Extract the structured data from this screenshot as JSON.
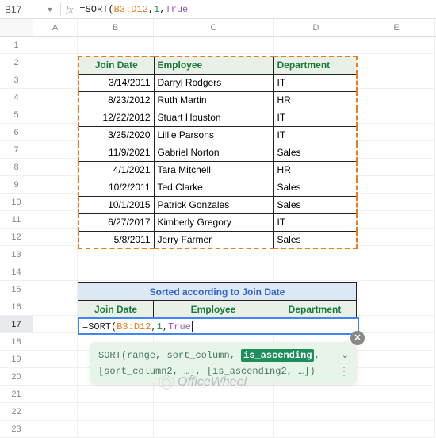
{
  "cellRef": "B17",
  "fxLabel": "fx",
  "formula": {
    "eq": "=",
    "fn": "SORT",
    "open": "(",
    "range": "B3:D12",
    "comma1": ",",
    "arg1": "1",
    "comma2": ",",
    "arg2": "True"
  },
  "columns": [
    "A",
    "B",
    "C",
    "D",
    "E"
  ],
  "rowCount": 23,
  "table1": {
    "headers": [
      "Join Date",
      "Employee",
      "Department"
    ],
    "rows": [
      [
        "3/14/2011",
        "Darryl Rodgers",
        "IT"
      ],
      [
        "8/23/2012",
        "Ruth Martin",
        "HR"
      ],
      [
        "12/22/2012",
        "Stuart Houston",
        "IT"
      ],
      [
        "3/25/2020",
        "Lillie Parsons",
        "IT"
      ],
      [
        "11/9/2021",
        "Gabriel Norton",
        "Sales"
      ],
      [
        "4/1/2021",
        "Tara Mitchell",
        "HR"
      ],
      [
        "10/2/2011",
        "Ted Clarke",
        "Sales"
      ],
      [
        "10/1/2015",
        "Patrick Gonzales",
        "Sales"
      ],
      [
        "6/27/2017",
        "Kimberly Gregory",
        "IT"
      ],
      [
        "5/8/2011",
        "Jerry Farmer",
        "Sales"
      ]
    ]
  },
  "table2": {
    "title": "Sorted according to Join Date",
    "headers": [
      "Join Date",
      "Employee",
      "Department"
    ]
  },
  "hint": {
    "fn": "SORT",
    "open": "(",
    "p1": "range",
    "c1": ", ",
    "p2": "sort_column",
    "c2": ", ",
    "p3": "is_ascending",
    "c3": ",",
    "line2": "[sort_column2, …], [is_ascending2, …])"
  },
  "watermark": "OfficeWheel",
  "closeIcon": "✕",
  "chevron": "⌄",
  "menuDots": "⋮"
}
